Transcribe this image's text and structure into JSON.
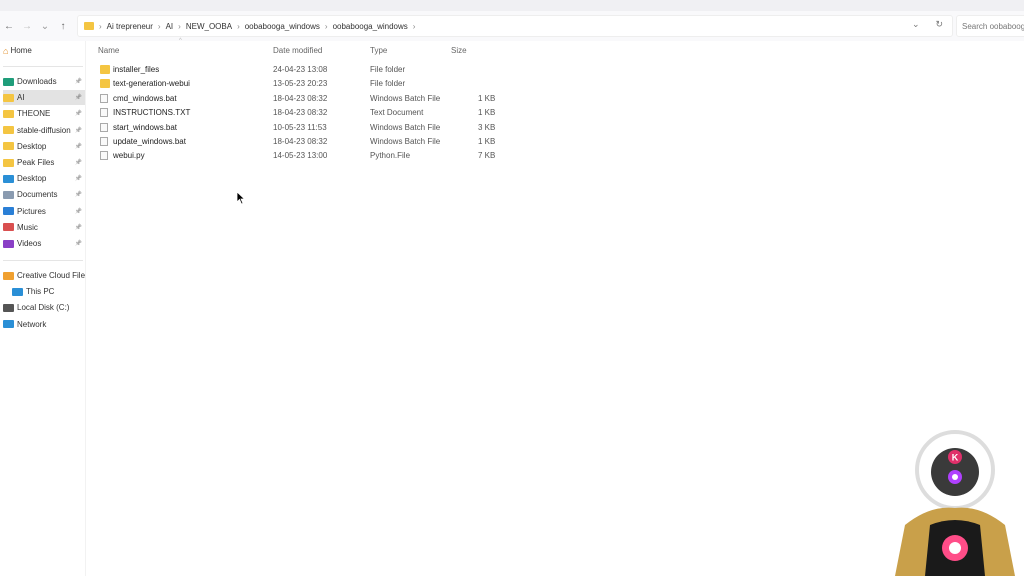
{
  "nav": {
    "back": "←",
    "forward": "→",
    "down": "⌄",
    "up": "↑"
  },
  "breadcrumb": [
    "Ai trepreneur",
    "AI",
    "NEW_OOBA",
    "oobabooga_windows",
    "oobabooga_windows"
  ],
  "address_right": {
    "dropdown": "⌄",
    "refresh": "↻"
  },
  "search": {
    "placeholder": "Search oobabooga_windows"
  },
  "sidebar": {
    "home": "Home",
    "pinned": [
      {
        "label": "Downloads",
        "color": "#1f9d7a"
      },
      {
        "label": "AI",
        "color": "#f4c542",
        "selected": true
      },
      {
        "label": "THEONE",
        "color": "#f4c542"
      },
      {
        "label": "stable-diffusion",
        "color": "#f4c542"
      },
      {
        "label": "Desktop",
        "color": "#f4c542"
      },
      {
        "label": "Peak Files",
        "color": "#f4c542"
      },
      {
        "label": "Desktop",
        "color": "#2a8fd6"
      },
      {
        "label": "Documents",
        "color": "#8a9bb0"
      },
      {
        "label": "Pictures",
        "color": "#2a7fd6"
      },
      {
        "label": "Music",
        "color": "#d94f4f"
      },
      {
        "label": "Videos",
        "color": "#8a3fc6"
      }
    ],
    "other": [
      {
        "label": "Creative Cloud Files",
        "color": "#f0a030"
      },
      {
        "label": "This PC",
        "color": "#2a8fd6"
      },
      {
        "label": "Local Disk (C:)",
        "color": "#555555"
      },
      {
        "label": "Network",
        "color": "#2a8fd6"
      }
    ]
  },
  "columns": {
    "name": "Name",
    "date": "Date modified",
    "type": "Type",
    "size": "Size"
  },
  "files": [
    {
      "name": "installer_files",
      "date": "24-04-23 13:08",
      "type": "File folder",
      "size": "",
      "icon": "folder"
    },
    {
      "name": "text-generation-webui",
      "date": "13-05-23 20:23",
      "type": "File folder",
      "size": "",
      "icon": "folder"
    },
    {
      "name": "cmd_windows.bat",
      "date": "18-04-23 08:32",
      "type": "Windows Batch File",
      "size": "1 KB",
      "icon": "bat"
    },
    {
      "name": "INSTRUCTIONS.TXT",
      "date": "18-04-23 08:32",
      "type": "Text Document",
      "size": "1 KB",
      "icon": "txt"
    },
    {
      "name": "start_windows.bat",
      "date": "10-05-23 11:53",
      "type": "Windows Batch File",
      "size": "3 KB",
      "icon": "bat"
    },
    {
      "name": "update_windows.bat",
      "date": "18-04-23 08:32",
      "type": "Windows Batch File",
      "size": "1 KB",
      "icon": "bat"
    },
    {
      "name": "webui.py",
      "date": "14-05-23 13:00",
      "type": "Python.File",
      "size": "7 KB",
      "icon": "txt"
    }
  ],
  "avatar_logo": "K"
}
